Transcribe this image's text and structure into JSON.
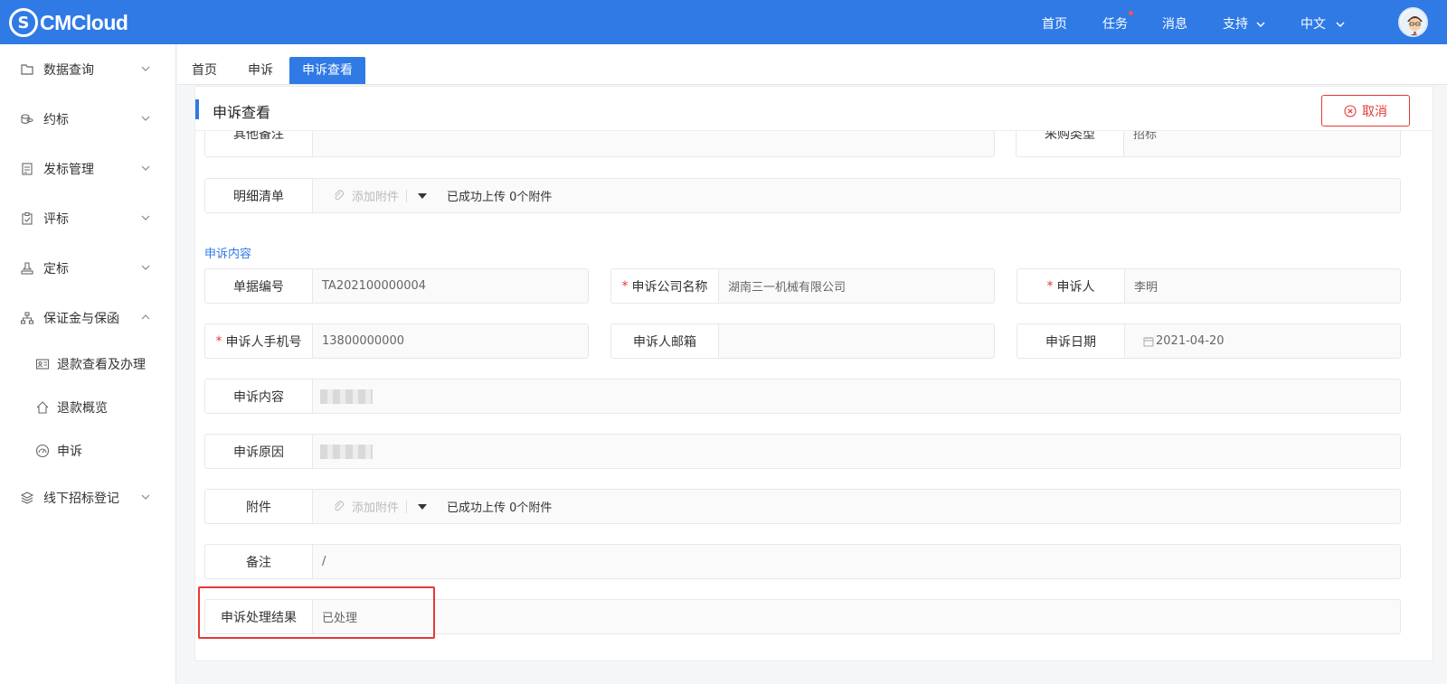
{
  "header": {
    "brand": "CMCloud",
    "nav": [
      "首页",
      "任务",
      "消息",
      "支持",
      "中文"
    ]
  },
  "sidebar": {
    "items": [
      {
        "label": "数据查询",
        "icon": "folder-icon"
      },
      {
        "label": "约标",
        "icon": "coins-icon"
      },
      {
        "label": "发标管理",
        "icon": "document-icon"
      },
      {
        "label": "评标",
        "icon": "clipboard-icon"
      },
      {
        "label": "定标",
        "icon": "stamp-icon"
      },
      {
        "label": "保证金与保函",
        "icon": "org-icon"
      },
      {
        "label": "线下招标登记",
        "icon": "layers-icon"
      }
    ],
    "subitems": [
      {
        "label": "退款查看及办理",
        "icon": "id-card-icon"
      },
      {
        "label": "退款概览",
        "icon": "house-icon"
      },
      {
        "label": "申诉",
        "icon": "gauge-icon"
      }
    ]
  },
  "tabs": [
    "首页",
    "申诉",
    "申诉查看"
  ],
  "page": {
    "title": "申诉查看",
    "cancel_label": "取消"
  },
  "form": {
    "top_partial": {
      "other_remark_label": "其他备注",
      "purchase_type_label": "采购类型",
      "purchase_type_value": "招标"
    },
    "detail_list": {
      "label": "明细清单",
      "attach_label": "添加附件",
      "upload_info": "已成功上传 0个附件"
    },
    "section_title": "申诉内容",
    "doc_no": {
      "label": "单据编号",
      "value": "TA202100000004"
    },
    "company": {
      "label": "申诉公司名称",
      "value": "湖南三一机械有限公司"
    },
    "person": {
      "label": "申诉人",
      "value": "李明"
    },
    "phone": {
      "label": "申诉人手机号",
      "value": "13800000000"
    },
    "email": {
      "label": "申诉人邮箱",
      "value": ""
    },
    "date": {
      "label": "申诉日期",
      "value": "2021-04-20"
    },
    "content": {
      "label": "申诉内容"
    },
    "reason": {
      "label": "申诉原因"
    },
    "attachment": {
      "label": "附件",
      "attach_label": "添加附件",
      "upload_info": "已成功上传 0个附件"
    },
    "remark": {
      "label": "备注",
      "value": "/"
    },
    "result": {
      "label": "申诉处理结果",
      "value": "已处理"
    }
  },
  "colors": {
    "primary": "#2f7ae5",
    "danger": "#e53935"
  }
}
